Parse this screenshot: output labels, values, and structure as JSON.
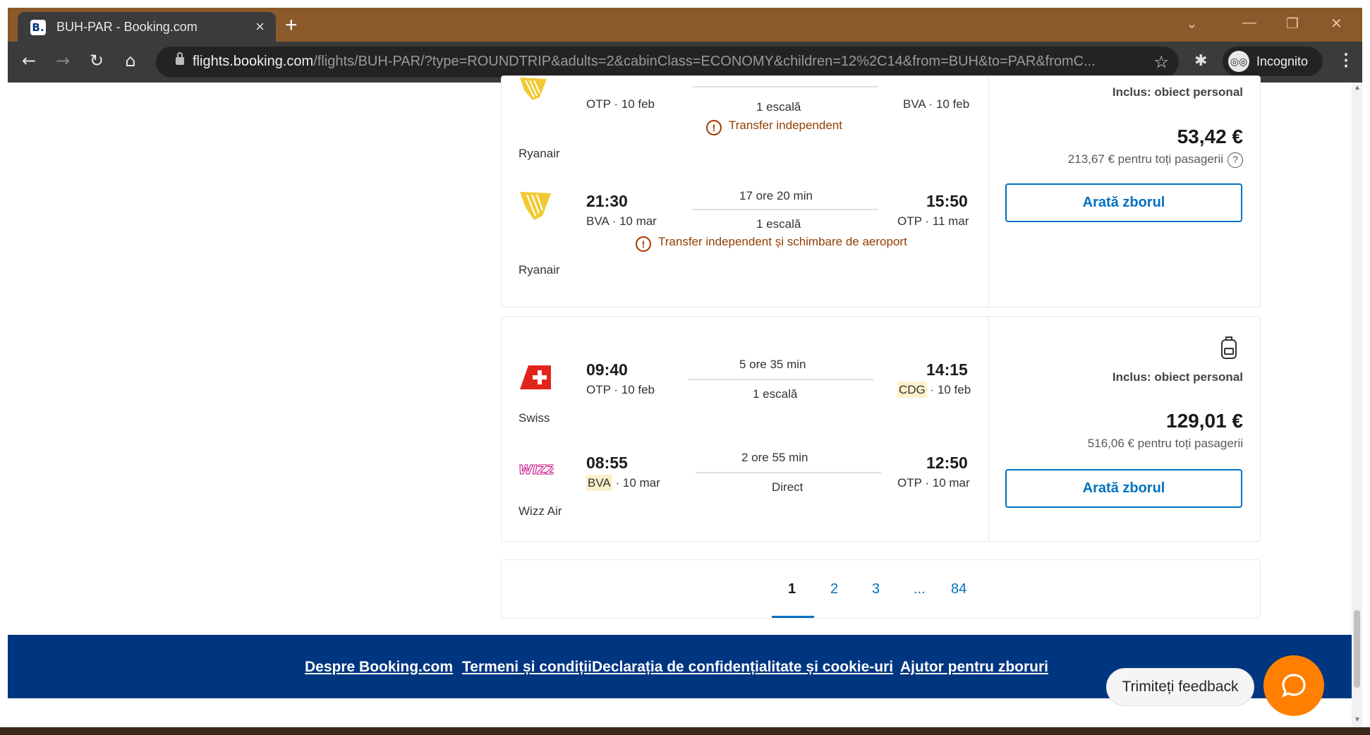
{
  "browser": {
    "tab_title": "BUH-PAR - Booking.com",
    "tab_favicon": "B.",
    "new_tab_label": "+",
    "url_host": "flights.booking.com",
    "url_path": "/flights/BUH-PAR/?type=ROUNDTRIP&adults=2&cabinClass=ECONOMY&children=12%2C14&from=BUH&to=PAR&fromC...",
    "incognito_label": "Incognito"
  },
  "results": [
    {
      "legs": [
        {
          "depart_code": "OTP",
          "depart_date": "10 feb",
          "stops": "1 escală",
          "arrive_code": "BVA",
          "arrive_date": "10 feb",
          "warning": "Transfer independent",
          "airline": "Ryanair"
        },
        {
          "depart_time": "21:30",
          "depart_code": "BVA",
          "depart_date": "10 mar",
          "duration": "17 ore 20 min",
          "stops": "1 escală",
          "arrive_time": "15:50",
          "arrive_code": "OTP",
          "arrive_date": "11 mar",
          "warning": "Transfer independent și schimbare de aeroport",
          "airline": "Ryanair"
        }
      ],
      "baggage": "Inclus: obiect personal",
      "price": "53,42 €",
      "price_total": "213,67 € pentru toți pasagerii",
      "cta": "Arată zborul"
    },
    {
      "legs": [
        {
          "depart_time": "09:40",
          "depart_code": "OTP",
          "depart_date": "10 feb",
          "duration": "5 ore 35 min",
          "stops": "1 escală",
          "arrive_time": "14:15",
          "arrive_code": "CDG",
          "arrive_date": "10 feb",
          "airline": "Swiss"
        },
        {
          "depart_time": "08:55",
          "depart_code": "BVA",
          "depart_date": "10 mar",
          "duration": "2 ore 55 min",
          "stops": "Direct",
          "arrive_time": "12:50",
          "arrive_code": "OTP",
          "arrive_date": "10 mar",
          "airline": "Wizz Air"
        }
      ],
      "baggage": "Inclus: obiect personal",
      "price": "129,01 €",
      "price_total": "516,06 € pentru toți pasagerii",
      "cta": "Arată zborul"
    }
  ],
  "pagination": {
    "current": "1",
    "pages": [
      "2",
      "3",
      "...",
      "84"
    ]
  },
  "footer": {
    "links": [
      "Despre Booking.com",
      "Termeni și condiții",
      "Declarația de confidențialitate și cookie-uri",
      "Ajutor pentru zboruri"
    ]
  },
  "feedback_label": "Trimiteți feedback",
  "icons": {
    "ryanair": "ryanair-harp-logo",
    "swiss": "swiss-flag-logo",
    "wizz": "wizz-air-logo",
    "backpack": "backpack-icon",
    "chat": "chat-bubble-icon"
  },
  "colors": {
    "accent": "#0071c2",
    "footer": "#003580",
    "warning": "#923e01",
    "chat_button": "#ff8000",
    "tabbar": "#8a5a2b"
  }
}
